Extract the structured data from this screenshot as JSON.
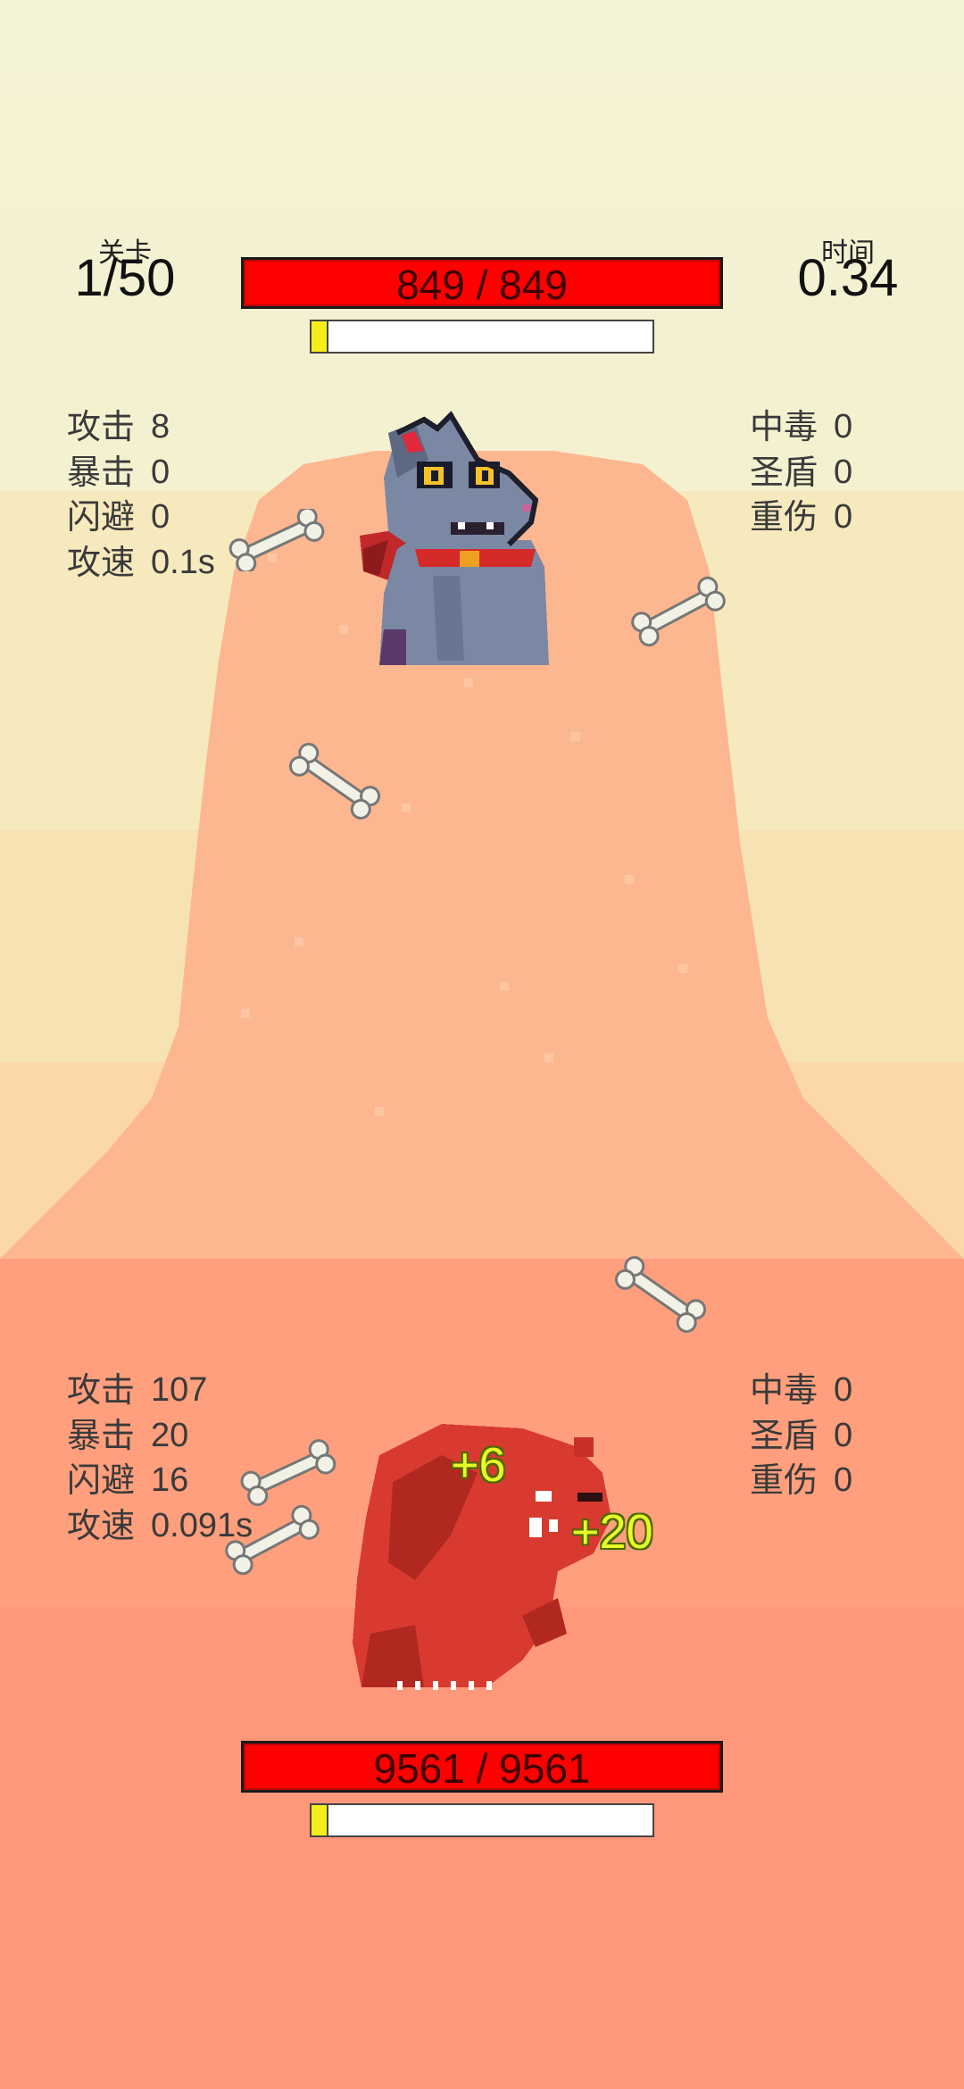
{
  "colors": {
    "sky_top": "#f4f1d2",
    "sky_mid": "#f6e8bf",
    "ground_mid": "#fcb186",
    "ground_bottom": "#ff9a7a",
    "hp_red": "#ff0000",
    "energy_yellow": "#f5ee1a"
  },
  "header": {
    "level_label": "关卡",
    "level_value": "1/50",
    "time_label": "时间",
    "time_value": "0.34"
  },
  "enemy": {
    "hp_text": "849 / 849",
    "energy_fraction": 0.05,
    "stats_left": [
      {
        "k": "攻击",
        "v": "8"
      },
      {
        "k": "暴击",
        "v": "0"
      },
      {
        "k": "闪避",
        "v": "0"
      },
      {
        "k": "攻速",
        "v": "0.1s"
      }
    ],
    "stats_right": [
      {
        "k": "中毒",
        "v": "0"
      },
      {
        "k": "圣盾",
        "v": "0"
      },
      {
        "k": "重伤",
        "v": "0"
      }
    ]
  },
  "player": {
    "hp_text": "9561 / 9561",
    "energy_fraction": 0.05,
    "stats_left": [
      {
        "k": "攻击",
        "v": "107"
      },
      {
        "k": "暴击",
        "v": "20"
      },
      {
        "k": "闪避",
        "v": "16"
      },
      {
        "k": "攻速",
        "v": "0.091s"
      }
    ],
    "stats_right": [
      {
        "k": "中毒",
        "v": "0"
      },
      {
        "k": "圣盾",
        "v": "0"
      },
      {
        "k": "重伤",
        "v": "0"
      }
    ],
    "heal_popups": [
      "+6",
      "+20"
    ]
  },
  "icons": [
    "grey-wolf-sprite",
    "red-bear-sprite",
    "bone-icon"
  ]
}
